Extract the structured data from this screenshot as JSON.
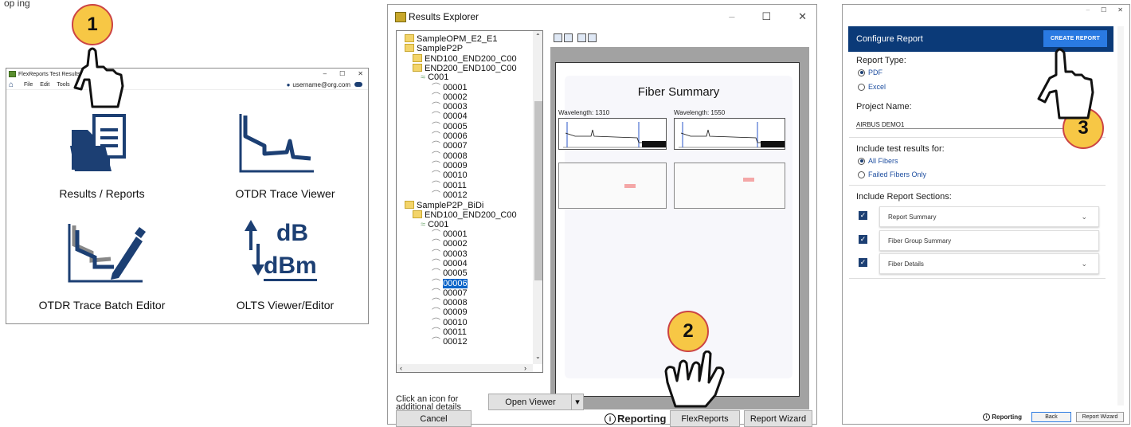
{
  "top_fragment": "op  ing",
  "win1": {
    "title": "FlexReports Test Results",
    "min": "–",
    "max": "☐",
    "close": "✕",
    "menu": [
      "File",
      "Edit",
      "Tools",
      "Ex"
    ],
    "user": "username@org.com",
    "tiles": [
      {
        "label": "Results / Reports",
        "icon": "folder-document-icon"
      },
      {
        "label": "OTDR Trace Viewer",
        "icon": "otdr-trace-icon"
      },
      {
        "label": "OTDR Trace Batch Editor",
        "icon": "trace-edit-pencil-icon"
      },
      {
        "label": "OLTS Viewer/Editor",
        "icon": "db-dbm-icon"
      }
    ],
    "olts_top": "dB",
    "olts_bottom": "dBm"
  },
  "win2": {
    "title": "Results Explorer",
    "min": "–",
    "max": "☐",
    "close": "✕",
    "tree": [
      {
        "text": "SampleOPM_E2_E1",
        "type": "folder",
        "indent": 0
      },
      {
        "text": "SampleP2P",
        "type": "folder",
        "indent": 0
      },
      {
        "text": "END100_END200_C00",
        "type": "folder",
        "indent": 1
      },
      {
        "text": "END200_END100_C00",
        "type": "folder",
        "indent": 1
      },
      {
        "text": "C001",
        "type": "fiber",
        "indent": 2
      },
      {
        "text": "00001",
        "type": "trace",
        "indent": 3
      },
      {
        "text": "00002",
        "type": "trace",
        "indent": 3
      },
      {
        "text": "00003",
        "type": "trace",
        "indent": 3
      },
      {
        "text": "00004",
        "type": "trace",
        "indent": 3
      },
      {
        "text": "00005",
        "type": "trace",
        "indent": 3
      },
      {
        "text": "00006",
        "type": "trace",
        "indent": 3
      },
      {
        "text": "00007",
        "type": "trace",
        "indent": 3
      },
      {
        "text": "00008",
        "type": "trace",
        "indent": 3
      },
      {
        "text": "00009",
        "type": "trace",
        "indent": 3
      },
      {
        "text": "00010",
        "type": "trace",
        "indent": 3
      },
      {
        "text": "00011",
        "type": "trace",
        "indent": 3
      },
      {
        "text": "00012",
        "type": "trace",
        "indent": 3
      },
      {
        "text": "SampleP2P_BiDi",
        "type": "folder",
        "indent": 0
      },
      {
        "text": "END100_END200_C00",
        "type": "folder",
        "indent": 1
      },
      {
        "text": "C001",
        "type": "fiber",
        "indent": 2
      },
      {
        "text": "00001",
        "type": "trace",
        "indent": 3
      },
      {
        "text": "00002",
        "type": "trace",
        "indent": 3
      },
      {
        "text": "00003",
        "type": "trace",
        "indent": 3
      },
      {
        "text": "00004",
        "type": "trace",
        "indent": 3
      },
      {
        "text": "00005",
        "type": "trace",
        "indent": 3
      },
      {
        "text": "00006",
        "type": "trace",
        "indent": 3,
        "selected": true
      },
      {
        "text": "00007",
        "type": "trace",
        "indent": 3
      },
      {
        "text": "00008",
        "type": "trace",
        "indent": 3
      },
      {
        "text": "00009",
        "type": "trace",
        "indent": 3
      },
      {
        "text": "00010",
        "type": "trace",
        "indent": 3
      },
      {
        "text": "00011",
        "type": "trace",
        "indent": 3
      },
      {
        "text": "00012",
        "type": "trace",
        "indent": 3
      }
    ],
    "preview": {
      "title": "Fiber Summary",
      "wl1": "Wavelength:  1310",
      "wl2": "Wavelength:  1550"
    },
    "hint": "Click an icon for additional details",
    "open_viewer": "Open Viewer",
    "dropdown_arrow": "▾",
    "cancel": "Cancel",
    "reporting": "Reporting",
    "flexreports": "FlexReports",
    "report_wizard": "Report Wizard"
  },
  "win3": {
    "min": "–",
    "max": "☐",
    "close": "✕",
    "header": "Configure Report",
    "create_btn": "CREATE REPORT",
    "report_type_label": "Report Type:",
    "report_types": [
      {
        "label": "PDF",
        "checked": true
      },
      {
        "label": "Excel",
        "checked": false
      }
    ],
    "project_label": "Project Name:",
    "project_value": "AIRBUS DEMO1",
    "include_label": "Include test results for:",
    "include_opts": [
      {
        "label": "All Fibers",
        "checked": true
      },
      {
        "label": "Failed Fibers Only",
        "checked": false
      }
    ],
    "sections_label": "Include Report Sections:",
    "sections": [
      {
        "label": "Report Summary",
        "checked": true,
        "chevron": true
      },
      {
        "label": "Fiber Group Summary",
        "checked": true,
        "chevron": false
      },
      {
        "label": "Fiber Details",
        "checked": true,
        "chevron": true
      }
    ],
    "reporting": "Reporting",
    "back": "Back",
    "report_wizard": "Report Wizard"
  },
  "callouts": [
    "1",
    "2",
    "3"
  ],
  "colors": {
    "brand_blue": "#1c3f73",
    "header_blue": "#0b3a78",
    "accent": "#2a7ae2",
    "badge": "#f7c745",
    "selection": "#0a64c8"
  }
}
